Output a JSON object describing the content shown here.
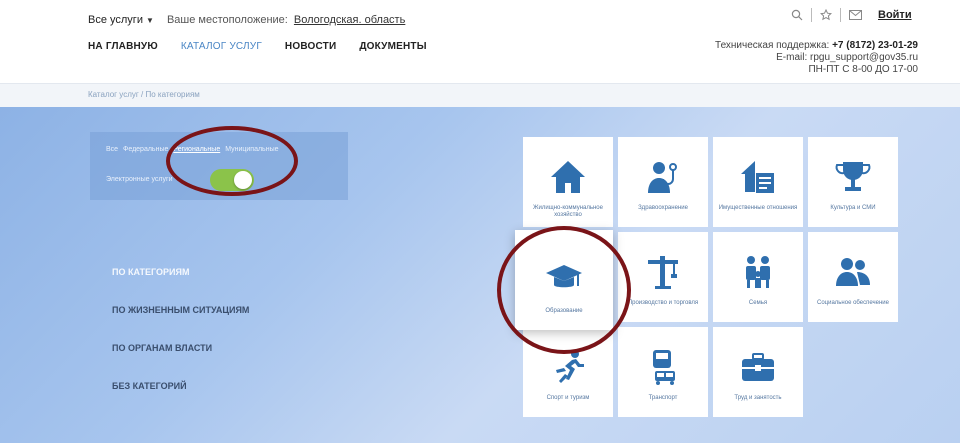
{
  "header": {
    "services_label": "Все услуги",
    "location_label": "Ваше местоположение:",
    "location_value": "Вологодская. область",
    "login": "Войти",
    "nav": [
      "НА ГЛАВНУЮ",
      "КАТАЛОГ УСЛУГ",
      "НОВОСТИ",
      "ДОКУМЕНТЫ"
    ],
    "icons": [
      "search-icon",
      "star-icon",
      "mail-icon"
    ],
    "support": {
      "line1_label": "Техническая поддержка:",
      "line1_phone": "+7 (8172) 23-01-29",
      "line2": "E-mail: rpgu_support@gov35.ru",
      "line3": "ПН-ПТ С 8-00 ДО 17-00"
    }
  },
  "breadcrumb": "Каталог услуг  /  По категориям",
  "filter": {
    "tabs": [
      "Все",
      "Федеральные",
      "Региональные",
      "Муниципальные"
    ],
    "selected": "Региональные",
    "e_label": "Электронные услуги",
    "toggle_on": true
  },
  "side": {
    "items": [
      "ПО КАТЕГОРИЯМ",
      "ПО ЖИЗНЕННЫМ СИТУАЦИЯМ",
      "ПО ОРГАНАМ ВЛАСТИ",
      "БЕЗ КАТЕГОРИЙ"
    ],
    "active": 0
  },
  "tiles": [
    {
      "label": "Жилищно-коммунальное хозяйство",
      "icon": "house-icon"
    },
    {
      "label": "Здравоохранение",
      "icon": "doctor-icon"
    },
    {
      "label": "Имущественные отношения",
      "icon": "property-icon"
    },
    {
      "label": "Культура и СМИ",
      "icon": "trophy-icon"
    },
    {
      "label": "Образование",
      "icon": "graduation-cap-icon"
    },
    {
      "label": "Производство и торговля",
      "icon": "crane-icon"
    },
    {
      "label": "Семья",
      "icon": "family-icon"
    },
    {
      "label": "Социальное обеспечение",
      "icon": "people-icon"
    },
    {
      "label": "Спорт и туризм",
      "icon": "runner-icon"
    },
    {
      "label": "Транспорт",
      "icon": "transport-icon"
    },
    {
      "label": "Труд и занятость",
      "icon": "briefcase-icon"
    }
  ],
  "colors": {
    "accent": "#4a86c5",
    "icon": "#2f6fae",
    "toggle": "#8bc34a",
    "annotation": "#7a1418"
  }
}
